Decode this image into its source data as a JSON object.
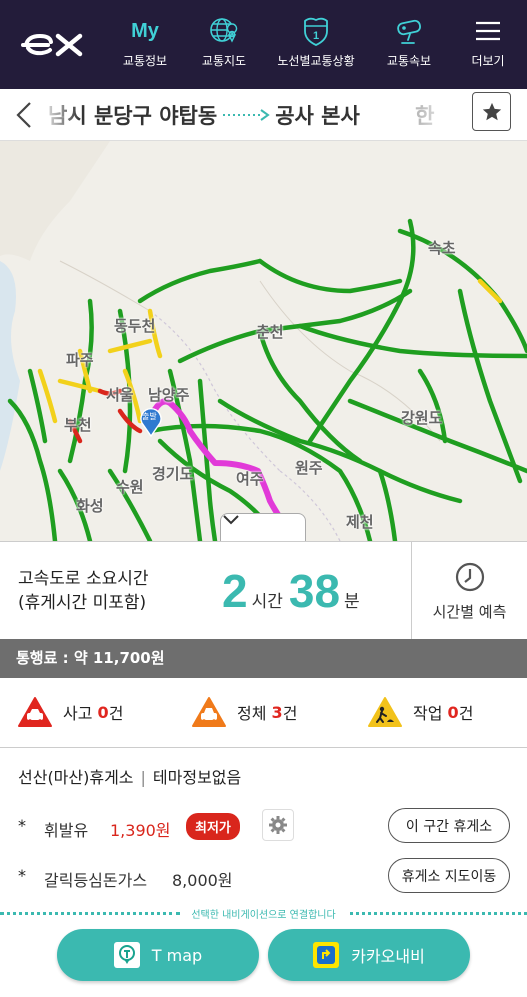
{
  "header": {
    "logo_text": "ex",
    "nav": [
      {
        "icon": "my-icon",
        "icon_text": "My",
        "label": "교통정보"
      },
      {
        "icon": "globe-pin-icon",
        "label": "교통지도"
      },
      {
        "icon": "route-shield-icon",
        "icon_text": "1",
        "label": "노선별교통상황"
      },
      {
        "icon": "cctv-camera-icon",
        "label": "교통속보"
      },
      {
        "icon": "hamburger-menu-icon",
        "label": "더보기"
      }
    ]
  },
  "route": {
    "origin": "남시 분당구 야탑동",
    "destination": "공사 본사",
    "trailing": "한"
  },
  "map": {
    "labels": {
      "sokcho": "속초",
      "dongducheon": "동두천",
      "chuncheon": "춘천",
      "paju": "파주",
      "seoul": "서울",
      "namyangju": "남양주",
      "gangwondo": "강원도",
      "bucheon": "부천",
      "gyeonggido": "경기도",
      "yeoju": "여주",
      "wonju": "원주",
      "suwon": "수원",
      "hwaseong": "화성",
      "jecheon": "제천"
    },
    "start_marker": "출발"
  },
  "travel": {
    "label_line1": "고속도로 소요시간",
    "label_line2": "(휴게시간 미포함)",
    "hours": "2",
    "hours_unit": "시간",
    "minutes": "38",
    "minutes_unit": "분",
    "forecast_label": "시간별 예측"
  },
  "toll": {
    "text": "통행료 : 약 11,700원"
  },
  "incidents": [
    {
      "label": "사고",
      "count": "0",
      "unit": "건",
      "color": "#e0261f"
    },
    {
      "label": "정체",
      "count": "3",
      "unit": "건",
      "color": "#f07a1a"
    },
    {
      "label": "작업",
      "count": "0",
      "unit": "건",
      "color": "#f2c21b"
    }
  ],
  "rest_area": {
    "name": "선산(마산)휴게소",
    "theme": "테마정보없음",
    "fuel": {
      "bullet": "*",
      "name": "휘발유",
      "price": "1,390원",
      "badge": "최저가"
    },
    "food": {
      "bullet": "*",
      "name": "갈릭등심돈가스",
      "price": "8,000원"
    },
    "section_button": "이 구간 휴게소",
    "map_button": "휴게소 지도이동"
  },
  "navigation": {
    "note": "선택한 내비게이션으로 연결합니다",
    "tmap_label": "T map",
    "kakao_label": "카카오내비"
  },
  "colors": {
    "header_bg": "#231c3a",
    "accent_teal": "#3bb9b0",
    "my_cyan": "#40d0d6",
    "road_green": "#1f9e20",
    "road_yellow": "#f2d11b",
    "road_red": "#d9261c",
    "route_magenta": "#e13ad8"
  }
}
